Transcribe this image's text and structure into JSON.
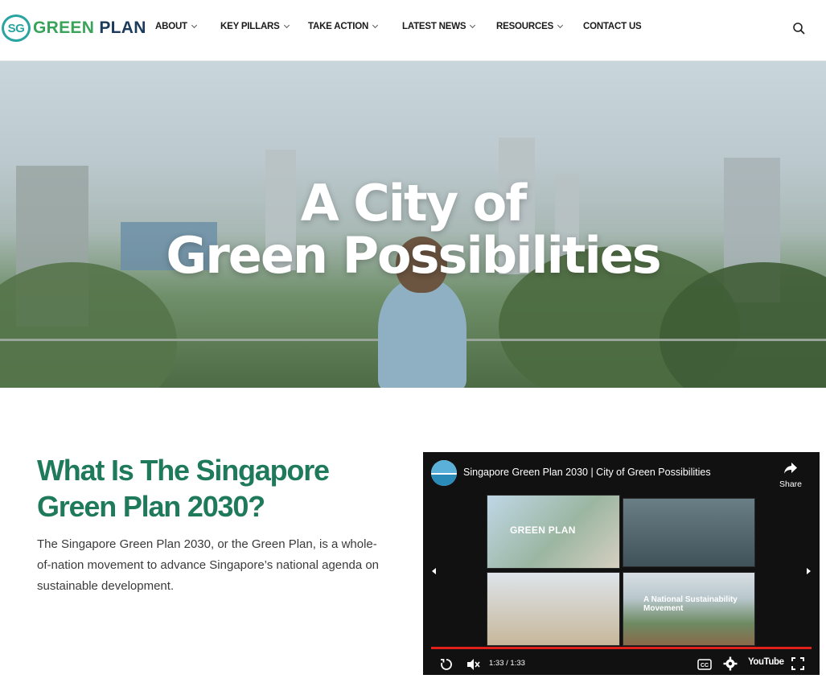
{
  "nav": {
    "logo_prefix": "SG",
    "logo_green": "GREEN",
    "logo_plan": "PLAN",
    "items": [
      {
        "label": "ABOUT",
        "has_dropdown": true
      },
      {
        "label": "KEY PILLARS",
        "has_dropdown": true
      },
      {
        "label": "TAKE ACTION",
        "has_dropdown": true
      },
      {
        "label": "LATEST NEWS",
        "has_dropdown": true
      },
      {
        "label": "RESOURCES",
        "has_dropdown": true
      },
      {
        "label": "CONTACT US",
        "has_dropdown": false
      }
    ],
    "search_icon": "search-icon"
  },
  "hero": {
    "title_line1": "A City of",
    "title_line2": "Green Possibilities"
  },
  "intro": {
    "title": "What Is The Singapore Green Plan 2030?",
    "description": "The Singapore Green Plan 2030, or the Green Plan, is a whole-of-nation movement to advance Singapore’s national agenda on sustainable development."
  },
  "video": {
    "title": "Singapore Green Plan 2030 | City of Green Possibilities",
    "share_label": "Share",
    "thumb1_logo": "GREEN PLAN",
    "thumb4_text": "A National Sustainability Movement",
    "time": "1:33 / 1:33",
    "platform": "YouTube",
    "progress": 1.0
  },
  "colors": {
    "brand_green": "#1f7a5c",
    "logo_teal": "#2aa4a0",
    "progress_red": "#e0201a"
  }
}
